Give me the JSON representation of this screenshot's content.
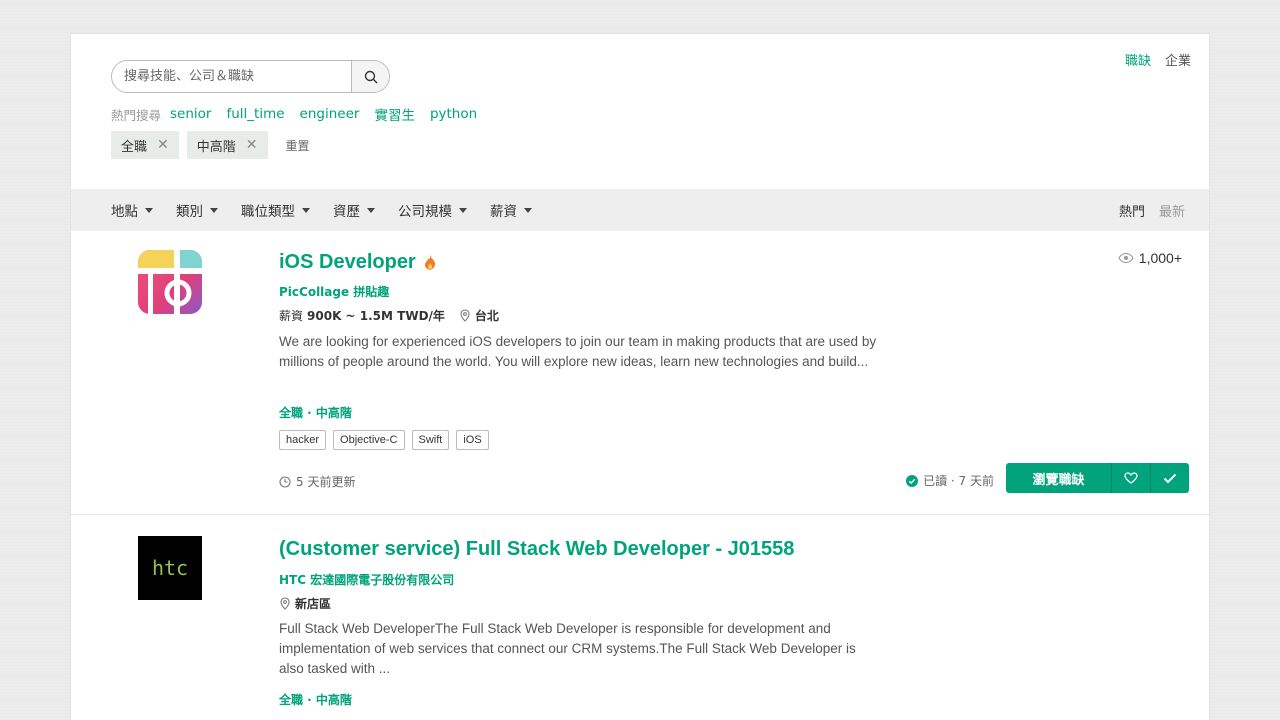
{
  "search": {
    "placeholder": "搜尋技能、公司＆職缺"
  },
  "top_nav": {
    "jobs": "職缺",
    "companies": "企業"
  },
  "hot_search": {
    "label": "熱門搜尋",
    "keywords": [
      "senior",
      "full_time",
      "engineer",
      "實習生",
      "python"
    ]
  },
  "active_filters": {
    "chips": [
      "全職",
      "中高階"
    ],
    "reset_label": "重置"
  },
  "filters": [
    "地點",
    "類別",
    "職位類型",
    "資歷",
    "公司規模",
    "薪資"
  ],
  "sort": {
    "hot": "熱門",
    "latest": "最新"
  },
  "jobs": [
    {
      "title": "iOS Developer",
      "company": "PicCollage 拼貼趣",
      "salary_label": "薪資",
      "salary": "900K ~ 1.5M TWD/年",
      "location": "台北",
      "description": "We are looking for experienced iOS developers to join our team in making products that are used by millions of people around the world. You will explore new ideas, learn new technologies and build...",
      "job_types": "全職 · 中高階",
      "tags": [
        "hacker",
        "Objective-C",
        "Swift",
        "iOS"
      ],
      "updated": "5 天前更新",
      "views": "1,000+",
      "applied": "已讀 · 7 天前",
      "view_button": "瀏覽職缺"
    },
    {
      "title": "(Customer service) Full Stack Web Developer - J01558",
      "company": "HTC 宏達國際電子股份有限公司",
      "logo_text": "htc",
      "location": "新店區",
      "description": "Full Stack Web DeveloperThe Full Stack Web Developer is responsible for development and implementation of web services that connect our CRM systems.The Full Stack Web Developer is also tasked with ...",
      "job_types": "全職 · 中高階"
    }
  ],
  "colors": {
    "accent": "#00a37b",
    "filter_bar": "#eeeeee",
    "chip_bg": "#e8ece9"
  }
}
